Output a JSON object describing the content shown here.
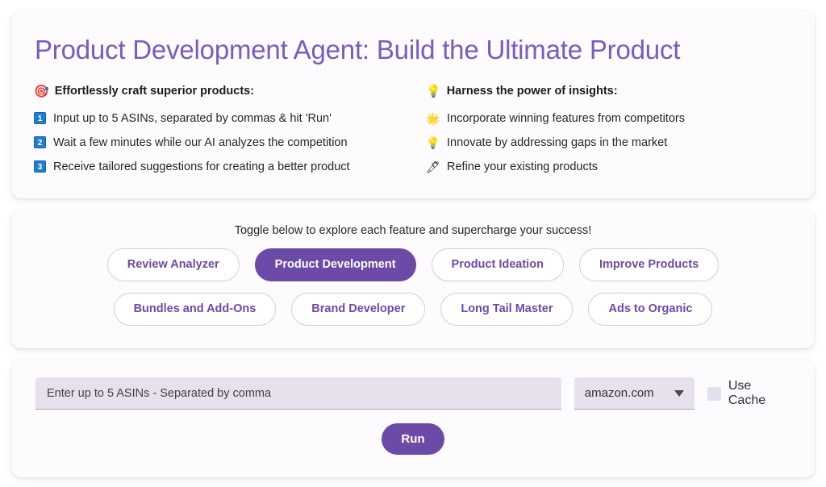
{
  "hero": {
    "title": "Product Development Agent: Build the Ultimate Product",
    "left": {
      "heading": "Effortlessly craft superior products:",
      "heading_icon": "dart-target-emoji",
      "steps": [
        {
          "num": "1",
          "text": "Input up to 5 ASINs, separated by commas & hit 'Run'"
        },
        {
          "num": "2",
          "text": "Wait a few minutes while our AI analyzes the competition"
        },
        {
          "num": "3",
          "text": "Receive tailored suggestions for creating a better product"
        }
      ]
    },
    "right": {
      "heading": "Harness the power of insights:",
      "heading_icon": "💡",
      "items": [
        {
          "icon": "🌟",
          "text": "Incorporate winning features from competitors"
        },
        {
          "icon": "💡",
          "text": "Innovate by addressing gaps in the market"
        },
        {
          "icon": "🖊",
          "text": "Refine your existing products"
        }
      ]
    }
  },
  "toggle": {
    "hint": "Toggle below to explore each feature and supercharge your success!",
    "row1": [
      {
        "label": "Review Analyzer",
        "active": false
      },
      {
        "label": "Product Development",
        "active": true
      },
      {
        "label": "Product Ideation",
        "active": false
      },
      {
        "label": "Improve Products",
        "active": false
      }
    ],
    "row2": [
      {
        "label": "Bundles and Add-Ons",
        "active": false
      },
      {
        "label": "Brand Developer",
        "active": false
      },
      {
        "label": "Long Tail Master",
        "active": false
      },
      {
        "label": "Ads to Organic",
        "active": false
      }
    ]
  },
  "form": {
    "asin_placeholder": "Enter up to 5 ASINs - Separated by comma",
    "asin_value": "",
    "marketplace_selected": "amazon.com",
    "marketplace_options": [
      "amazon.com"
    ],
    "use_cache_label": "Use Cache",
    "use_cache_checked": false,
    "run_label": "Run"
  },
  "colors": {
    "accent_purple": "#6b4aa8",
    "title_purple": "#7a5bbf",
    "card_background": "#fdfbfe",
    "input_background": "#e7e1ee",
    "pill_border": "#d2d0d9",
    "keycap_blue": "#1f7ed0"
  }
}
